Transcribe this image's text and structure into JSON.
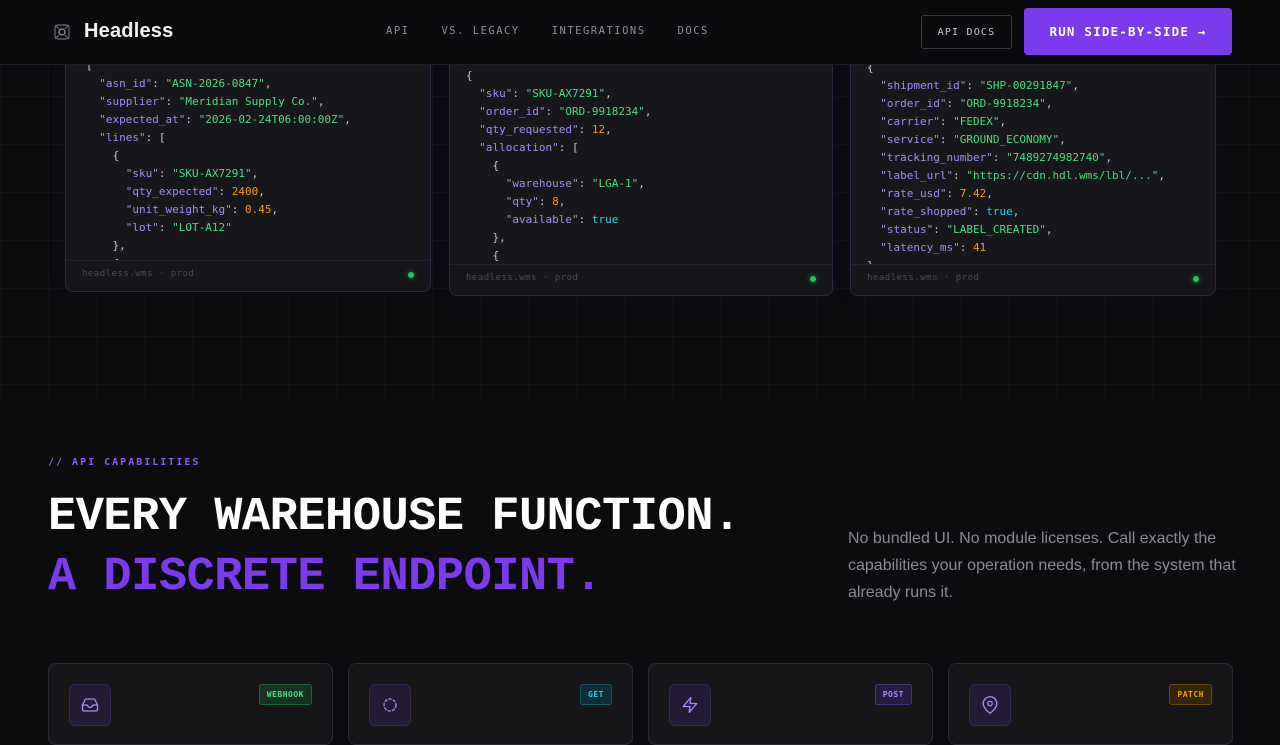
{
  "nav": {
    "brand": "Headless",
    "links": [
      "API",
      "VS. LEGACY",
      "INTEGRATIONS",
      "DOCS"
    ],
    "docs_button": "API DOCS",
    "cta_button": "RUN SIDE-BY-SIDE →"
  },
  "panels": [
    {
      "footer": "headless.wms · prod",
      "lines": [
        "[",
        "  \"asn_id\": \"ASN-2026-0847\",",
        "  \"supplier\": \"Meridian Supply Co.\",",
        "  \"expected_at\": \"2026-02-24T06:00:00Z\",",
        "  \"lines\": [",
        "    {",
        "      \"sku\": \"SKU-AX7291\",",
        "      \"qty_expected\": 2400,",
        "      \"unit_weight_kg\": 0.45,",
        "      \"lot\": \"LOT-A12\"",
        "    },",
        "    {"
      ]
    },
    {
      "footer": "headless.wms · prod",
      "lines": [
        "[",
        "{",
        "  \"sku\": \"SKU-AX7291\",",
        "  \"order_id\": \"ORD-9918234\",",
        "  \"qty_requested\": 12,",
        "  \"allocation\": [",
        "    {",
        "      \"warehouse\": \"LGA-1\",",
        "      \"qty\": 8,",
        "      \"available\": true",
        "    },",
        "    {"
      ]
    },
    {
      "footer": "headless.wms · prod",
      "lines": [
        "{",
        "  \"shipment_id\": \"SHP-00291847\",",
        "  \"order_id\": \"ORD-9918234\",",
        "  \"carrier\": \"FEDEX\",",
        "  \"service\": \"GROUND_ECONOMY\",",
        "  \"tracking_number\": \"7489274982740\",",
        "  \"label_url\": \"https://cdn.hdl.wms/lbl/...\",",
        "  \"rate_usd\": 7.42,",
        "  \"rate_shopped\": true,",
        "  \"status\": \"LABEL_CREATED\",",
        "  \"latency_ms\": 41",
        "}"
      ]
    }
  ],
  "capabilities": {
    "eyebrow": "// API CAPABILITIES",
    "headline_line1": "EVERY WAREHOUSE FUNCTION.",
    "headline_line2": "A DISCRETE ENDPOINT.",
    "lede": "No bundled UI. No module licenses. Call exactly the capabilities your operation needs, from the system that already runs it.",
    "cards": [
      {
        "badge": "WEBHOOK",
        "icon": "inbox-icon"
      },
      {
        "badge": "GET",
        "icon": "scan-icon"
      },
      {
        "badge": "POST",
        "icon": "lightning-icon"
      },
      {
        "badge": "PATCH",
        "icon": "map-pin-icon"
      }
    ]
  },
  "colors": {
    "accent": "#7c3aed",
    "background": "#0c0c0e",
    "json_key": "#a78bfa",
    "json_string": "#4ade80",
    "json_number": "#f59e0b",
    "json_bool": "#22d3ee",
    "status_ok": "#22c55e"
  }
}
